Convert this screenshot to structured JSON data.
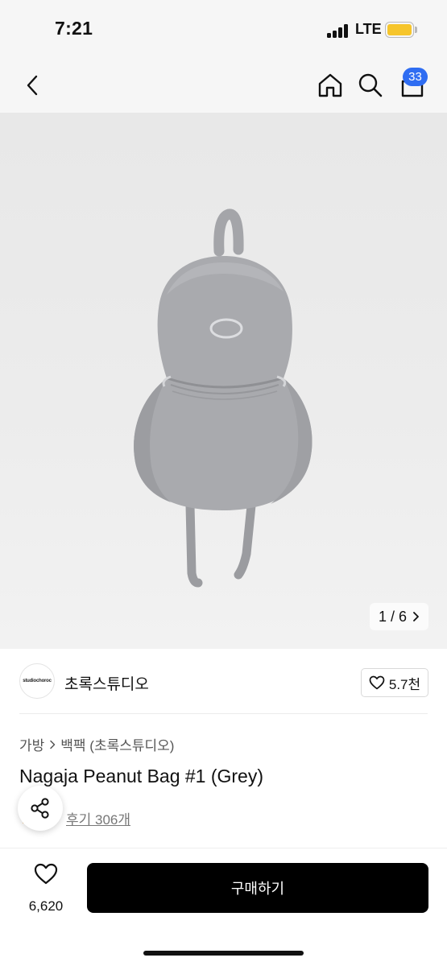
{
  "status_bar": {
    "time": "7:21",
    "network": "LTE"
  },
  "nav": {
    "cart_count": "33"
  },
  "hero": {
    "image_counter": "1 / 6"
  },
  "brand": {
    "logo_text": "studiochoroc",
    "name": "초록스튜디오",
    "likes": "5.7천"
  },
  "breadcrumb": {
    "category": "가방",
    "subcategory": "백팩 (초록스튜디오)"
  },
  "product": {
    "title": "Nagaja Peanut Bag #1 (Grey)",
    "reviews": "후기 306개"
  },
  "bottom": {
    "wish_count": "6,620",
    "buy_label": "구매하기"
  },
  "colors": {
    "badge": "#2f6df2",
    "battery": "#f6c52b",
    "bag": "#a8a9ad",
    "buy_button": "#000000"
  }
}
